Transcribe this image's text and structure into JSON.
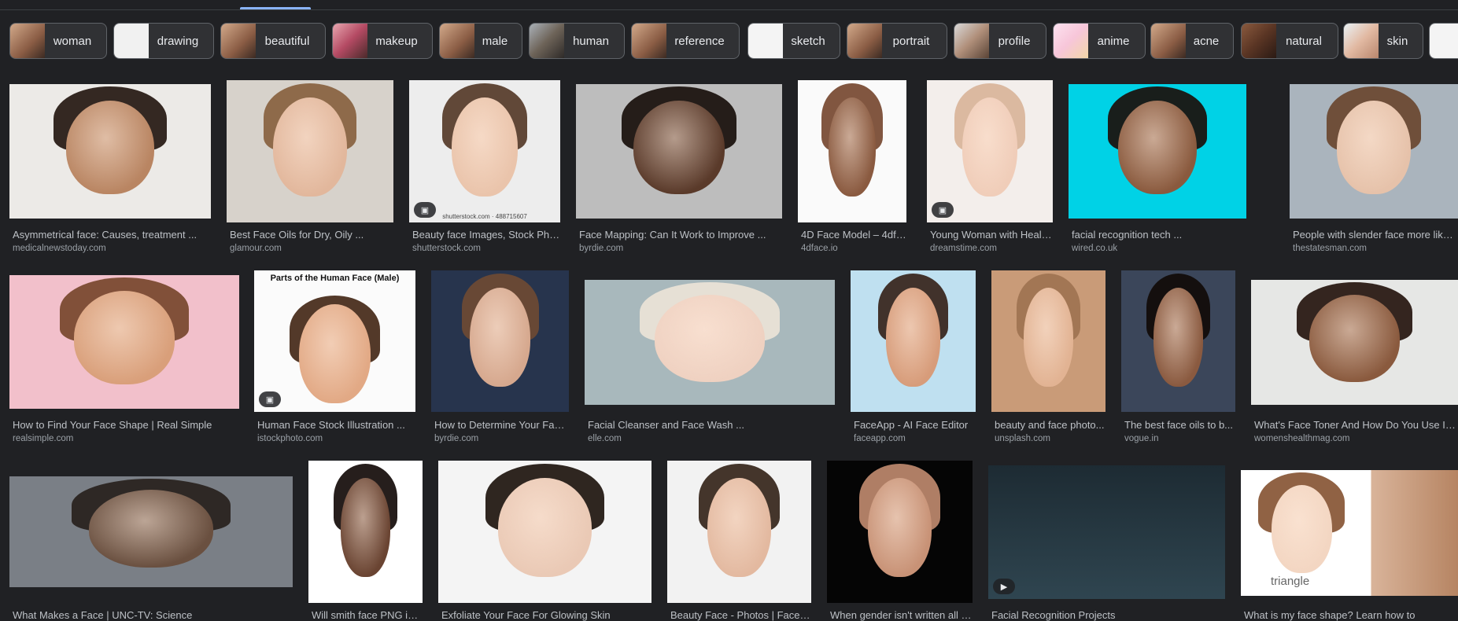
{
  "chips": [
    {
      "label": "woman"
    },
    {
      "label": "drawing"
    },
    {
      "label": "beautiful"
    },
    {
      "label": "makeup"
    },
    {
      "label": "male"
    },
    {
      "label": "human"
    },
    {
      "label": "reference"
    },
    {
      "label": "sketch"
    },
    {
      "label": "portrait"
    },
    {
      "label": "profile"
    },
    {
      "label": "anime"
    },
    {
      "label": "acne"
    },
    {
      "label": "natural"
    },
    {
      "label": "skin"
    }
  ],
  "results": [
    {
      "title": "Asymmetrical face: Causes, treatment ...",
      "source": "medicalnewstoday.com"
    },
    {
      "title": "Best Face Oils for Dry, Oily ...",
      "source": "glamour.com"
    },
    {
      "title": "Beauty face Images, Stock Phot...",
      "source": "shutterstock.com",
      "stamp": "shutterstock.com · 488715607"
    },
    {
      "title": "Face Mapping: Can It Work to Improve ...",
      "source": "byrdie.com"
    },
    {
      "title": "4D Face Model – 4dface",
      "source": "4dface.io"
    },
    {
      "title": "Young Woman with Healt...",
      "source": "dreamstime.com"
    },
    {
      "title": "facial recognition tech ...",
      "source": "wired.co.uk"
    },
    {
      "title": "People with slender face more likely to",
      "source": "thestatesman.com"
    },
    {
      "title": "How to Find Your Face Shape | Real Simple",
      "source": "realsimple.com"
    },
    {
      "title": "Human Face Stock Illustration ...",
      "source": "istockphoto.com",
      "diagram_title": "Parts of the Human Face (Male)"
    },
    {
      "title": "How to Determine Your Face...",
      "source": "byrdie.com"
    },
    {
      "title": "Facial Cleanser and Face Wash ...",
      "source": "elle.com"
    },
    {
      "title": "FaceApp - AI Face Editor",
      "source": "faceapp.com"
    },
    {
      "title": "beauty and face photo...",
      "source": "unsplash.com"
    },
    {
      "title": "The best face oils to b...",
      "source": "vogue.in"
    },
    {
      "title": "What's Face Toner And How Do You Use It ...",
      "source": "womenshealthmag.com"
    },
    {
      "title": "What Makes a Face | UNC-TV: Science",
      "source": ""
    },
    {
      "title": "Will smith face PNG im...",
      "source": ""
    },
    {
      "title": "Exfoliate Your Face For Glowing Skin",
      "source": ""
    },
    {
      "title": "Beauty Face - Photos | Facebo...",
      "source": ""
    },
    {
      "title": "When gender isn't written all o...",
      "source": ""
    },
    {
      "title": "Facial Recognition Projects",
      "source": ""
    },
    {
      "title": "What is my face shape? Learn how to",
      "source": "",
      "shape_label": "triangle"
    }
  ]
}
